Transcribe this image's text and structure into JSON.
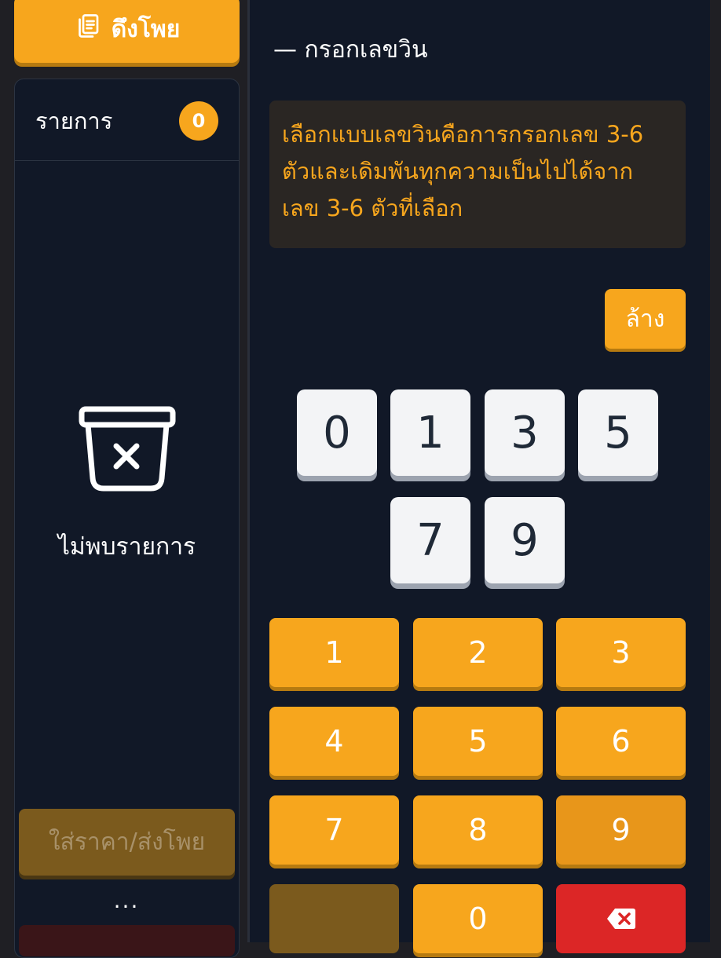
{
  "left": {
    "pull_button_label": "ดึงโพย",
    "list_title": "รายการ",
    "list_count": "0",
    "empty_message": "ไม่พบรายการ",
    "price_button_label": "ใส่ราคา/ส่งโพย",
    "more_label": "..."
  },
  "main": {
    "section_title": "— กรอกเลขวิน",
    "info_text": "เลือกแบบเลขวินคือการกรอกเลข 3-6 ตัวและเดิมพันทุกความเป็นไปได้จาก เลข 3-6 ตัวที่เลือก",
    "clear_label": "ล้าง",
    "selected_numbers": [
      "0",
      "1",
      "3",
      "5",
      "7",
      "9"
    ],
    "keypad": [
      "1",
      "2",
      "3",
      "4",
      "5",
      "6",
      "7",
      "8",
      "9",
      "",
      "0",
      ""
    ]
  },
  "colors": {
    "accent": "#f7a61d",
    "panel": "#111827",
    "delete": "#dc2626",
    "info_bg": "#2a2623"
  },
  "icons": {
    "pull": "clipboard-icon",
    "empty": "empty-box-icon",
    "delete": "backspace-icon"
  }
}
